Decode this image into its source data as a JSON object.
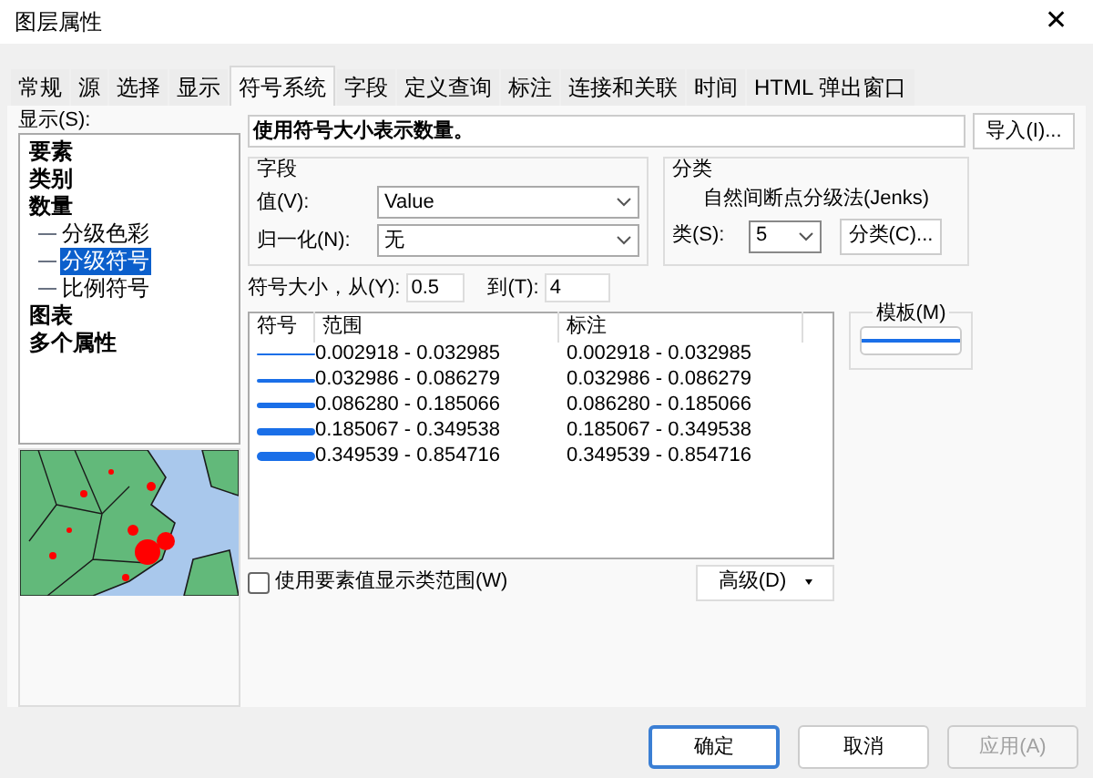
{
  "window": {
    "title": "图层属性",
    "close": "✕"
  },
  "tabs": [
    {
      "label": "常规",
      "selected": false
    },
    {
      "label": "源",
      "selected": false
    },
    {
      "label": "选择",
      "selected": false
    },
    {
      "label": "显示",
      "selected": false
    },
    {
      "label": "符号系统",
      "selected": true
    },
    {
      "label": "字段",
      "selected": false
    },
    {
      "label": "定义查询",
      "selected": false
    },
    {
      "label": "标注",
      "selected": false
    },
    {
      "label": "连接和关联",
      "selected": false
    },
    {
      "label": "时间",
      "selected": false
    },
    {
      "label": "HTML 弹出窗口",
      "selected": false
    }
  ],
  "show_label": "显示(S):",
  "show_tree": [
    {
      "label": "要素",
      "selected": false
    },
    {
      "label": "类别",
      "selected": false
    },
    {
      "label": "数量",
      "selected": false,
      "children": [
        {
          "label": "分级色彩",
          "selected": false
        },
        {
          "label": "分级符号",
          "selected": true
        },
        {
          "label": "比例符号",
          "selected": false
        }
      ]
    },
    {
      "label": "图表",
      "selected": false
    },
    {
      "label": "多个属性",
      "selected": false
    }
  ],
  "description": "使用符号大小表示数量。",
  "import_button": "导入(I)...",
  "field_group": {
    "title": "字段",
    "value_label": "值(V):",
    "value": "Value",
    "normalize_label": "归一化(N):",
    "normalize": "无"
  },
  "classification": {
    "title": "分类",
    "method": "自然间断点分级法(Jenks)",
    "classes_label": "类(S):",
    "classes": "5",
    "classify_button": "分类(C)..."
  },
  "size": {
    "from_label": "符号大小，从(Y):",
    "from": "0.5",
    "to_label": "到(T):",
    "to": "4"
  },
  "template_label": "模板(M)",
  "legend": {
    "columns": [
      "符号",
      "范围",
      "标注"
    ],
    "rows": [
      {
        "range": "0.002918 - 0.032985",
        "label": "0.002918 - 0.032985"
      },
      {
        "range": "0.032986 - 0.086279",
        "label": "0.032986 - 0.086279"
      },
      {
        "range": "0.086280 - 0.185066",
        "label": "0.086280 - 0.185066"
      },
      {
        "range": "0.185067 - 0.349538",
        "label": "0.185067 - 0.349538"
      },
      {
        "range": "0.349539 - 0.854716",
        "label": "0.349539 - 0.854716"
      }
    ]
  },
  "show_class_ranges": {
    "label": "使用要素值显示类范围(W)",
    "checked": false
  },
  "advanced_button": "高级(D)",
  "buttons": [
    {
      "label": "确定",
      "disabled": false,
      "default": true
    },
    {
      "label": "取消",
      "disabled": false,
      "default": false
    },
    {
      "label": "应用(A)",
      "disabled": true,
      "default": false
    }
  ]
}
